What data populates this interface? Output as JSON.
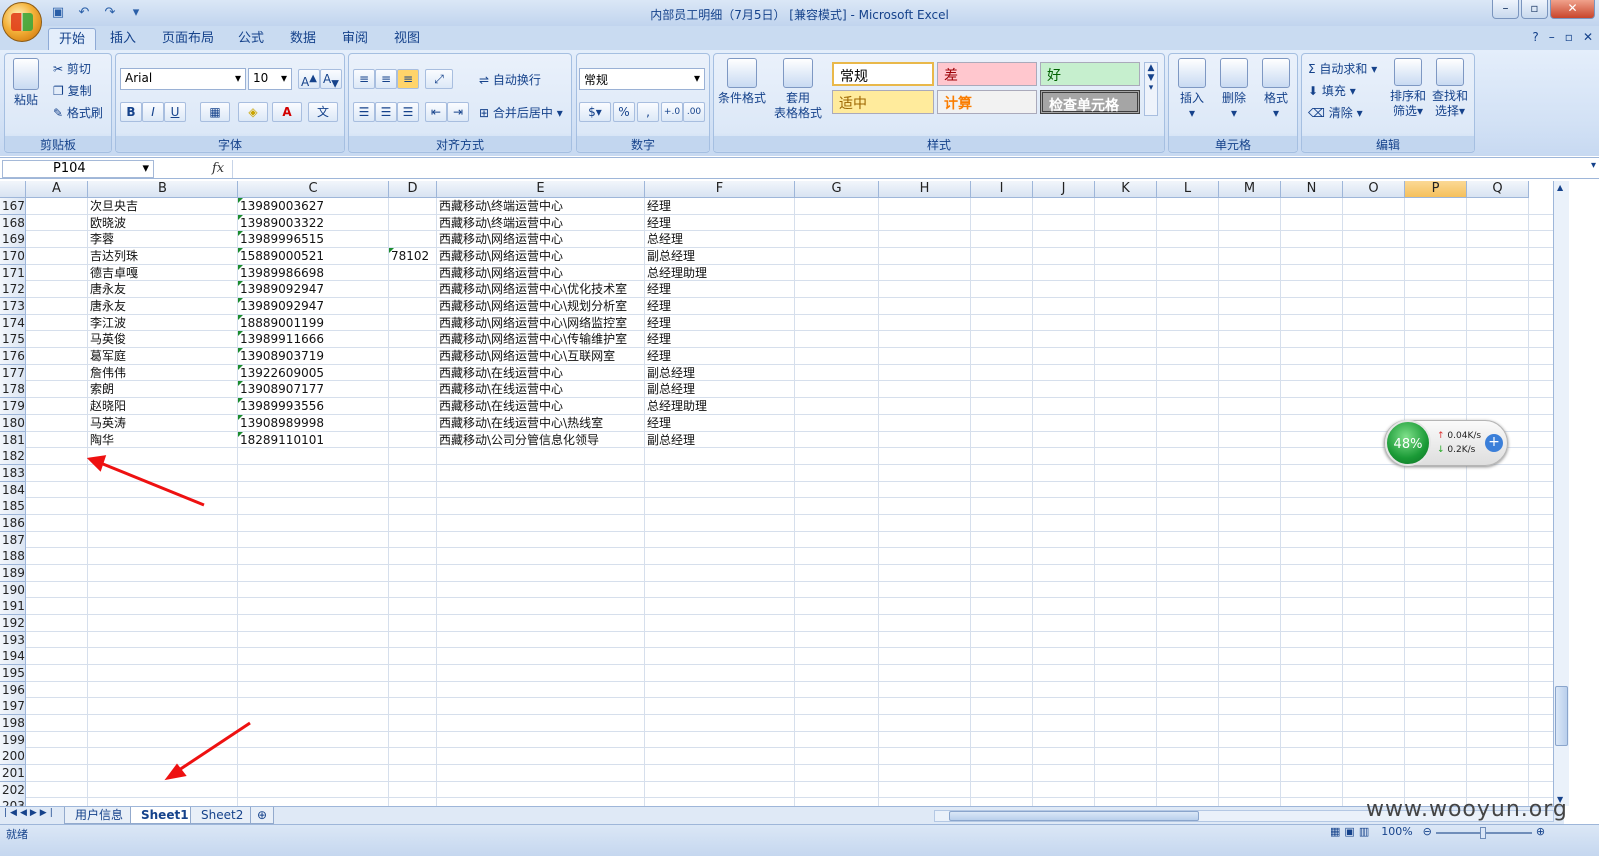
{
  "window": {
    "title": "内部员工明细（7月5日）  [兼容模式] - Microsoft Excel"
  },
  "ribbon_tabs": [
    "开始",
    "插入",
    "页面布局",
    "公式",
    "数据",
    "审阅",
    "视图"
  ],
  "clipboard": {
    "paste": "粘贴",
    "cut": "剪切",
    "copy": "复制",
    "format_painter": "格式刷",
    "label": "剪贴板"
  },
  "font": {
    "name": "Arial",
    "size": "10",
    "bold": "B",
    "italic": "I",
    "underline": "U",
    "label": "字体"
  },
  "alignment": {
    "wrap": "自动换行",
    "merge": "合并后居中",
    "label": "对齐方式"
  },
  "number": {
    "format": "常规",
    "percent": "%",
    "comma": ",",
    "inc": "+.0",
    "dec": ".00",
    "label": "数字"
  },
  "styles": {
    "conditional": "条件格式",
    "table1": "套用",
    "table2": "表格格式",
    "normal": "常规",
    "bad": "差",
    "good": "好",
    "neutral": "适中",
    "calc": "计算",
    "check": "检查单元格",
    "label": "样式"
  },
  "cells": {
    "insert": "插入",
    "delete": "删除",
    "format": "格式",
    "label": "单元格"
  },
  "editing": {
    "autosum": "自动求和",
    "fill": "填充",
    "clear": "清除",
    "sort1": "排序和",
    "sort2": "筛选",
    "find1": "查找和",
    "find2": "选择",
    "label": "编辑"
  },
  "formula_bar": {
    "name_box": "P104",
    "fx": "fx"
  },
  "columns": [
    "A",
    "B",
    "C",
    "D",
    "E",
    "F",
    "G",
    "H",
    "I",
    "J",
    "K",
    "L",
    "M",
    "N",
    "O",
    "P",
    "Q"
  ],
  "rows": [
    {
      "n": "167",
      "name": "次旦央吉",
      "phone": "13989003627",
      "ext": "",
      "dept": "西藏移动\\终端运营中心",
      "title": "经理"
    },
    {
      "n": "168",
      "name": "欧晓波",
      "phone": "13989003322",
      "ext": "",
      "dept": "西藏移动\\终端运营中心",
      "title": "经理"
    },
    {
      "n": "169",
      "name": "李蓉",
      "phone": "13989996515",
      "ext": "",
      "dept": "西藏移动\\网络运营中心",
      "title": "总经理"
    },
    {
      "n": "170",
      "name": "吉达列珠",
      "phone": "15889000521",
      "ext": "78102",
      "dept": "西藏移动\\网络运营中心",
      "title": "副总经理"
    },
    {
      "n": "171",
      "name": "德吉卓嘎",
      "phone": "13989986698",
      "ext": "",
      "dept": "西藏移动\\网络运营中心",
      "title": "总经理助理"
    },
    {
      "n": "172",
      "name": "唐永友",
      "phone": "13989092947",
      "ext": "",
      "dept": "西藏移动\\网络运营中心\\优化技术室",
      "title": "经理"
    },
    {
      "n": "173",
      "name": "唐永友",
      "phone": "13989092947",
      "ext": "",
      "dept": "西藏移动\\网络运营中心\\规划分析室",
      "title": "经理"
    },
    {
      "n": "174",
      "name": "李江波",
      "phone": "18889001199",
      "ext": "",
      "dept": "西藏移动\\网络运营中心\\网络监控室",
      "title": "经理"
    },
    {
      "n": "175",
      "name": "马英俊",
      "phone": "13989911666",
      "ext": "",
      "dept": "西藏移动\\网络运营中心\\传输维护室",
      "title": "经理"
    },
    {
      "n": "176",
      "name": "葛军庭",
      "phone": "13908903719",
      "ext": "",
      "dept": "西藏移动\\网络运营中心\\互联网室",
      "title": "经理"
    },
    {
      "n": "177",
      "name": "詹伟伟",
      "phone": "13922609005",
      "ext": "",
      "dept": "西藏移动\\在线运营中心",
      "title": "副总经理"
    },
    {
      "n": "178",
      "name": "索朗",
      "phone": "13908907177",
      "ext": "",
      "dept": "西藏移动\\在线运营中心",
      "title": "副总经理"
    },
    {
      "n": "179",
      "name": "赵晓阳",
      "phone": "13989993556",
      "ext": "",
      "dept": "西藏移动\\在线运营中心",
      "title": "总经理助理"
    },
    {
      "n": "180",
      "name": "马英涛",
      "phone": "13908989998",
      "ext": "",
      "dept": "西藏移动\\在线运营中心\\热线室",
      "title": "经理"
    },
    {
      "n": "181",
      "name": "陶华",
      "phone": "18289110101",
      "ext": "",
      "dept": "西藏移动\\公司分管信息化领导",
      "title": "副总经理"
    }
  ],
  "empty_rows": [
    "182",
    "183",
    "184",
    "185",
    "186",
    "187",
    "188",
    "189",
    "190",
    "191",
    "192",
    "193",
    "194",
    "195",
    "196",
    "197",
    "198",
    "199",
    "200",
    "201",
    "202",
    "203"
  ],
  "sheets": [
    "用户信息",
    "Sheet1",
    "Sheet2"
  ],
  "status": {
    "ready": "就绪",
    "zoom": "100%"
  },
  "net_widget": {
    "percent": "48%",
    "up": "0.04K/s",
    "down": "0.2K/s"
  },
  "watermark": "www.wooyun.org"
}
